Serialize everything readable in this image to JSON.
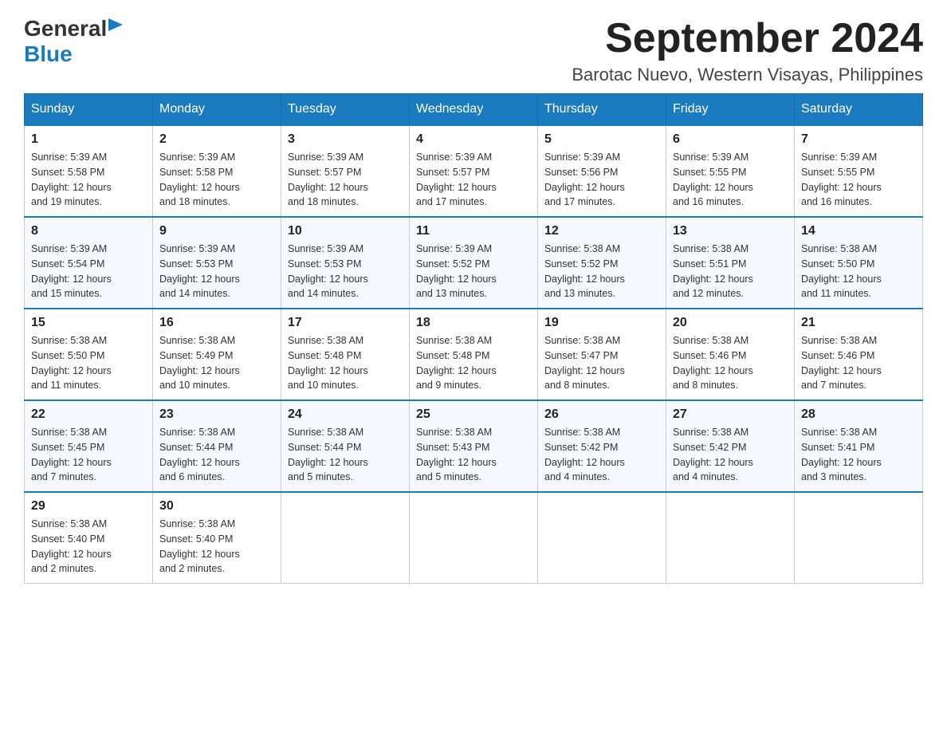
{
  "header": {
    "logo_general": "General",
    "logo_blue": "Blue",
    "month_year": "September 2024",
    "location": "Barotac Nuevo, Western Visayas, Philippines"
  },
  "days_of_week": [
    "Sunday",
    "Monday",
    "Tuesday",
    "Wednesday",
    "Thursday",
    "Friday",
    "Saturday"
  ],
  "weeks": [
    [
      {
        "day": "1",
        "sunrise": "5:39 AM",
        "sunset": "5:58 PM",
        "daylight": "12 hours and 19 minutes."
      },
      {
        "day": "2",
        "sunrise": "5:39 AM",
        "sunset": "5:58 PM",
        "daylight": "12 hours and 18 minutes."
      },
      {
        "day": "3",
        "sunrise": "5:39 AM",
        "sunset": "5:57 PM",
        "daylight": "12 hours and 18 minutes."
      },
      {
        "day": "4",
        "sunrise": "5:39 AM",
        "sunset": "5:57 PM",
        "daylight": "12 hours and 17 minutes."
      },
      {
        "day": "5",
        "sunrise": "5:39 AM",
        "sunset": "5:56 PM",
        "daylight": "12 hours and 17 minutes."
      },
      {
        "day": "6",
        "sunrise": "5:39 AM",
        "sunset": "5:55 PM",
        "daylight": "12 hours and 16 minutes."
      },
      {
        "day": "7",
        "sunrise": "5:39 AM",
        "sunset": "5:55 PM",
        "daylight": "12 hours and 16 minutes."
      }
    ],
    [
      {
        "day": "8",
        "sunrise": "5:39 AM",
        "sunset": "5:54 PM",
        "daylight": "12 hours and 15 minutes."
      },
      {
        "day": "9",
        "sunrise": "5:39 AM",
        "sunset": "5:53 PM",
        "daylight": "12 hours and 14 minutes."
      },
      {
        "day": "10",
        "sunrise": "5:39 AM",
        "sunset": "5:53 PM",
        "daylight": "12 hours and 14 minutes."
      },
      {
        "day": "11",
        "sunrise": "5:39 AM",
        "sunset": "5:52 PM",
        "daylight": "12 hours and 13 minutes."
      },
      {
        "day": "12",
        "sunrise": "5:38 AM",
        "sunset": "5:52 PM",
        "daylight": "12 hours and 13 minutes."
      },
      {
        "day": "13",
        "sunrise": "5:38 AM",
        "sunset": "5:51 PM",
        "daylight": "12 hours and 12 minutes."
      },
      {
        "day": "14",
        "sunrise": "5:38 AM",
        "sunset": "5:50 PM",
        "daylight": "12 hours and 11 minutes."
      }
    ],
    [
      {
        "day": "15",
        "sunrise": "5:38 AM",
        "sunset": "5:50 PM",
        "daylight": "12 hours and 11 minutes."
      },
      {
        "day": "16",
        "sunrise": "5:38 AM",
        "sunset": "5:49 PM",
        "daylight": "12 hours and 10 minutes."
      },
      {
        "day": "17",
        "sunrise": "5:38 AM",
        "sunset": "5:48 PM",
        "daylight": "12 hours and 10 minutes."
      },
      {
        "day": "18",
        "sunrise": "5:38 AM",
        "sunset": "5:48 PM",
        "daylight": "12 hours and 9 minutes."
      },
      {
        "day": "19",
        "sunrise": "5:38 AM",
        "sunset": "5:47 PM",
        "daylight": "12 hours and 8 minutes."
      },
      {
        "day": "20",
        "sunrise": "5:38 AM",
        "sunset": "5:46 PM",
        "daylight": "12 hours and 8 minutes."
      },
      {
        "day": "21",
        "sunrise": "5:38 AM",
        "sunset": "5:46 PM",
        "daylight": "12 hours and 7 minutes."
      }
    ],
    [
      {
        "day": "22",
        "sunrise": "5:38 AM",
        "sunset": "5:45 PM",
        "daylight": "12 hours and 7 minutes."
      },
      {
        "day": "23",
        "sunrise": "5:38 AM",
        "sunset": "5:44 PM",
        "daylight": "12 hours and 6 minutes."
      },
      {
        "day": "24",
        "sunrise": "5:38 AM",
        "sunset": "5:44 PM",
        "daylight": "12 hours and 5 minutes."
      },
      {
        "day": "25",
        "sunrise": "5:38 AM",
        "sunset": "5:43 PM",
        "daylight": "12 hours and 5 minutes."
      },
      {
        "day": "26",
        "sunrise": "5:38 AM",
        "sunset": "5:42 PM",
        "daylight": "12 hours and 4 minutes."
      },
      {
        "day": "27",
        "sunrise": "5:38 AM",
        "sunset": "5:42 PM",
        "daylight": "12 hours and 4 minutes."
      },
      {
        "day": "28",
        "sunrise": "5:38 AM",
        "sunset": "5:41 PM",
        "daylight": "12 hours and 3 minutes."
      }
    ],
    [
      {
        "day": "29",
        "sunrise": "5:38 AM",
        "sunset": "5:40 PM",
        "daylight": "12 hours and 2 minutes."
      },
      {
        "day": "30",
        "sunrise": "5:38 AM",
        "sunset": "5:40 PM",
        "daylight": "12 hours and 2 minutes."
      },
      null,
      null,
      null,
      null,
      null
    ]
  ],
  "labels": {
    "sunrise_prefix": "Sunrise: ",
    "sunset_prefix": "Sunset: ",
    "daylight_prefix": "Daylight: "
  }
}
